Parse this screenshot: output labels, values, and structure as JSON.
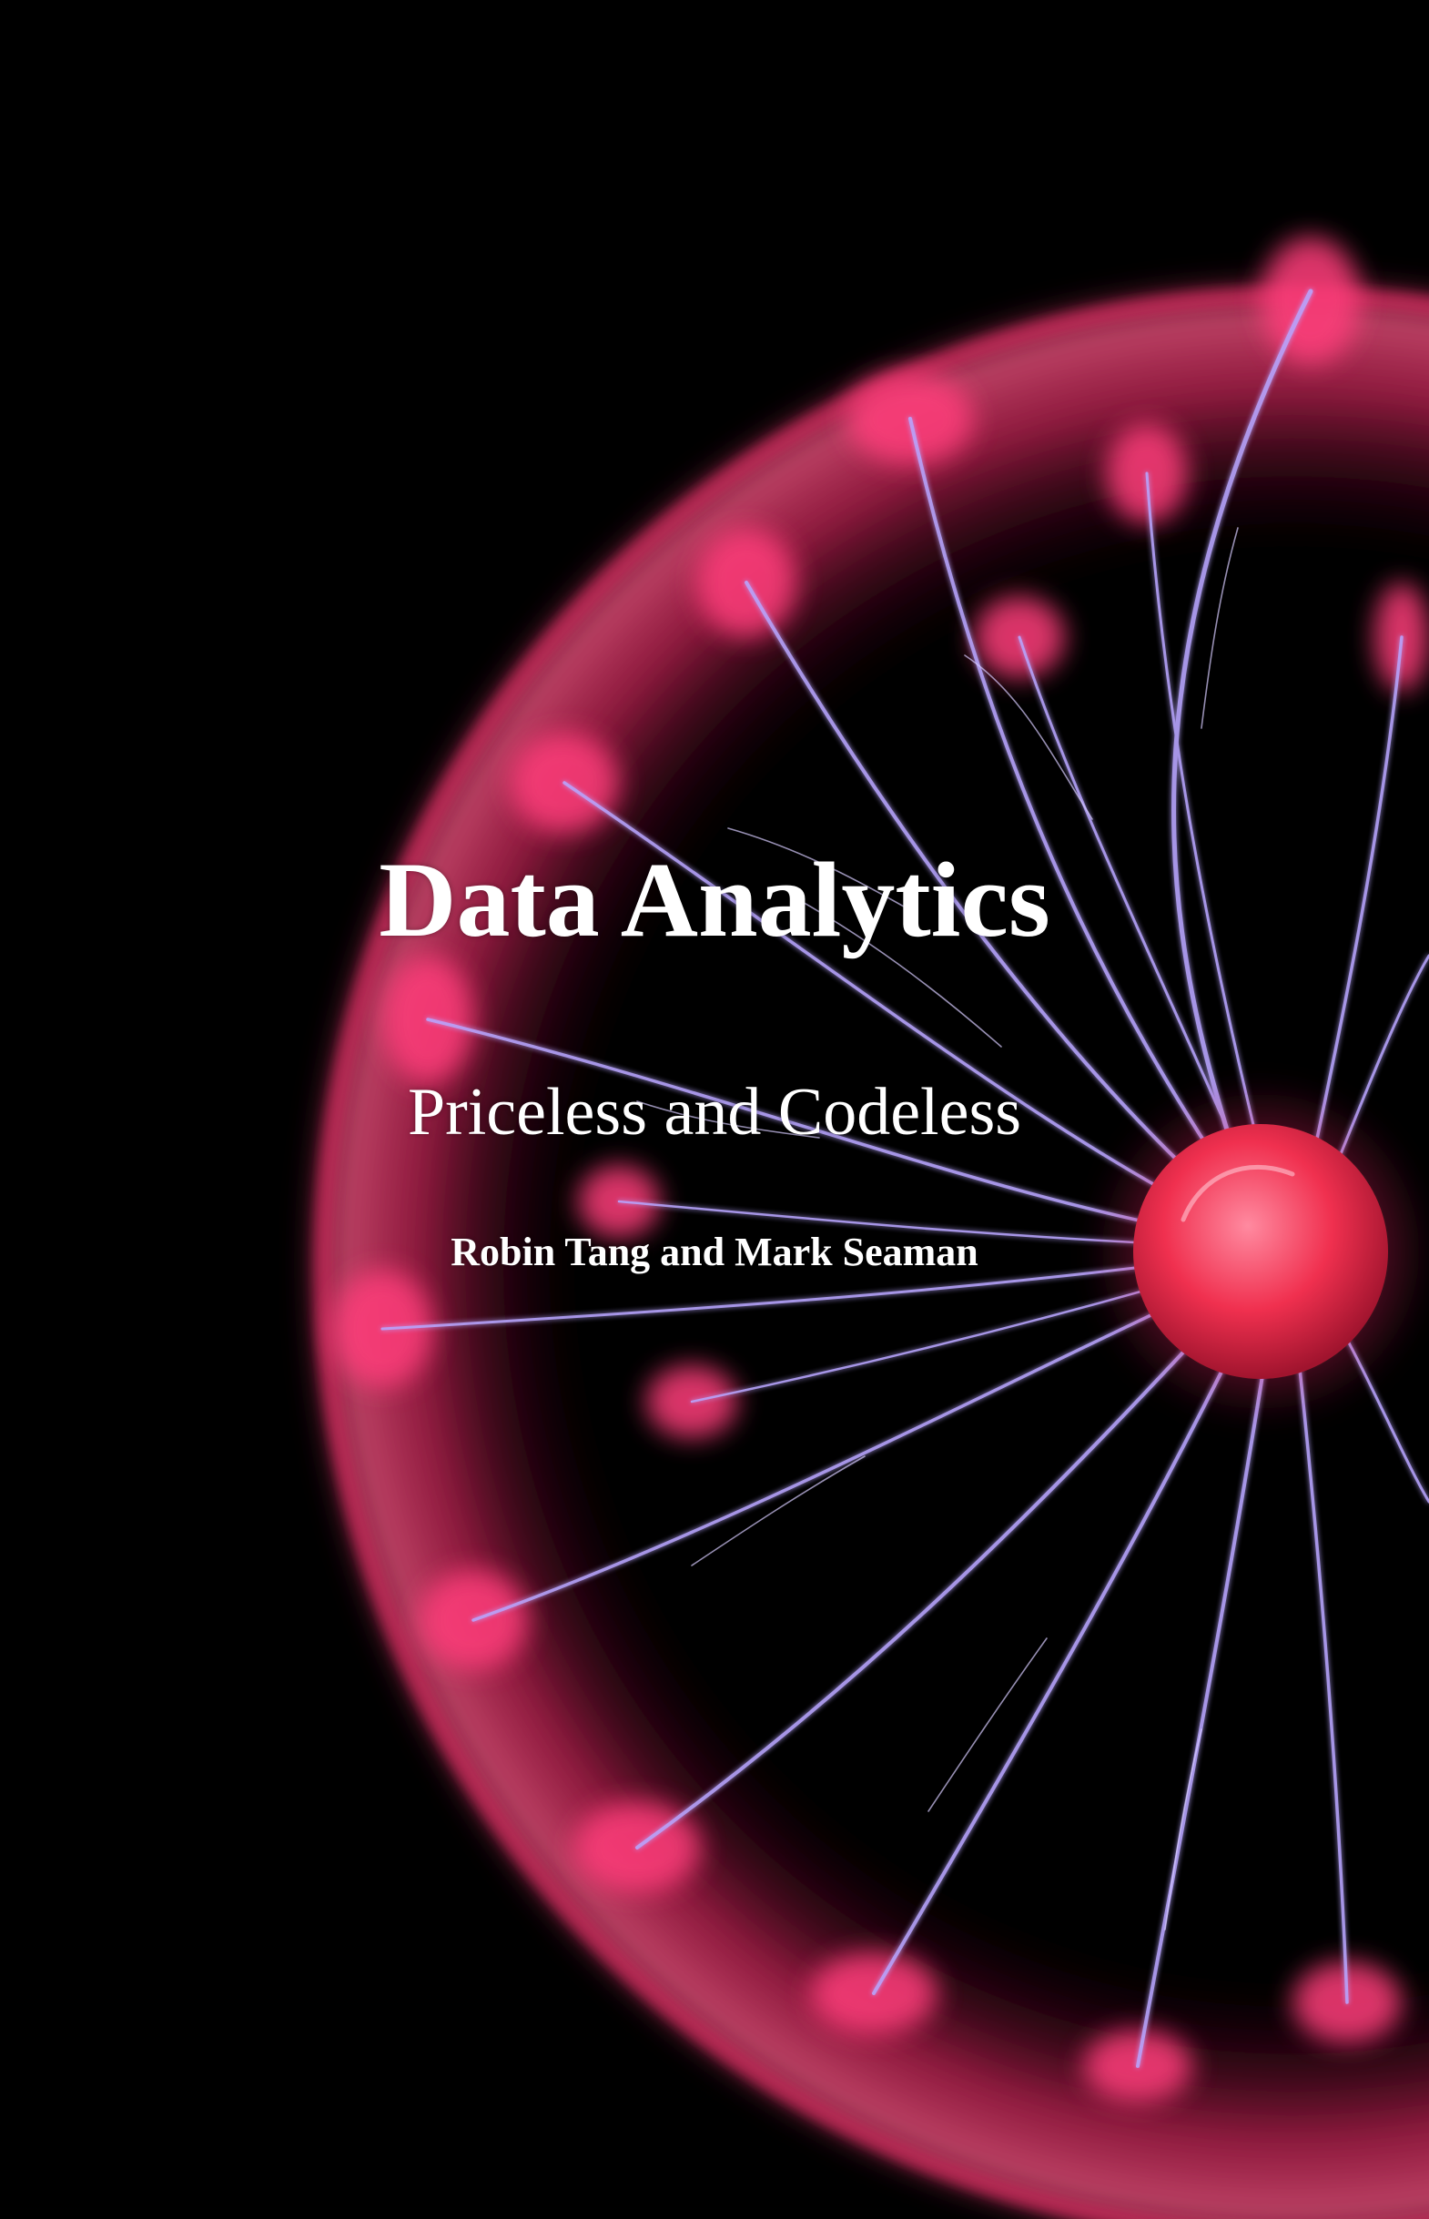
{
  "cover": {
    "title": "Data Analytics",
    "subtitle": "Priceless and Codeless",
    "authors": "Robin Tang and Mark Seaman"
  },
  "artwork": {
    "subject": "plasma-ball",
    "colors": {
      "background": "#000000",
      "glow": "#ff2d6e",
      "filament": "#b8a6ff",
      "core": "#ff3b5c"
    }
  }
}
